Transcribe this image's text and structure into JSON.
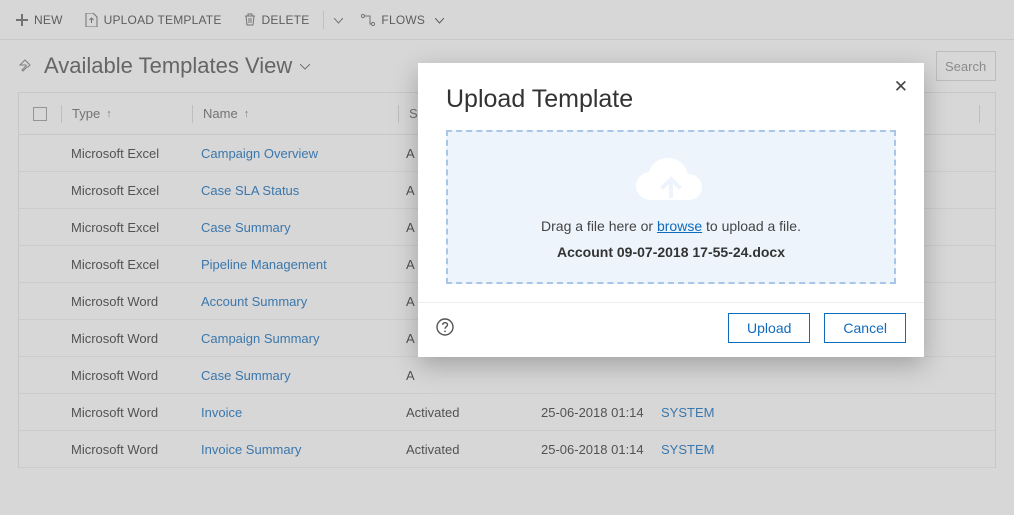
{
  "toolbar": {
    "new_label": "NEW",
    "upload_template_label": "UPLOAD TEMPLATE",
    "delete_label": "DELETE",
    "flows_label": "FLOWS"
  },
  "view": {
    "title": "Available Templates View",
    "search_placeholder": "Search"
  },
  "grid": {
    "columns": {
      "type": "Type",
      "name": "Name",
      "status": "S",
      "modified": "",
      "modified_by": ""
    },
    "rows": [
      {
        "type": "Microsoft Excel",
        "name": "Campaign Overview",
        "status": "A",
        "modified": "",
        "modified_by": ""
      },
      {
        "type": "Microsoft Excel",
        "name": "Case SLA Status",
        "status": "A",
        "modified": "",
        "modified_by": ""
      },
      {
        "type": "Microsoft Excel",
        "name": "Case Summary",
        "status": "A",
        "modified": "",
        "modified_by": ""
      },
      {
        "type": "Microsoft Excel",
        "name": "Pipeline Management",
        "status": "A",
        "modified": "",
        "modified_by": ""
      },
      {
        "type": "Microsoft Word",
        "name": "Account Summary",
        "status": "A",
        "modified": "",
        "modified_by": ""
      },
      {
        "type": "Microsoft Word",
        "name": "Campaign Summary",
        "status": "A",
        "modified": "",
        "modified_by": ""
      },
      {
        "type": "Microsoft Word",
        "name": "Case Summary",
        "status": "A",
        "modified": "",
        "modified_by": ""
      },
      {
        "type": "Microsoft Word",
        "name": "Invoice",
        "status": "Activated",
        "modified": "25-06-2018 01:14",
        "modified_by": "SYSTEM"
      },
      {
        "type": "Microsoft Word",
        "name": "Invoice Summary",
        "status": "Activated",
        "modified": "25-06-2018 01:14",
        "modified_by": "SYSTEM"
      }
    ]
  },
  "modal": {
    "title": "Upload Template",
    "dropzone_prefix": "Drag a file here or ",
    "dropzone_browse": "browse",
    "dropzone_suffix": " to upload a file.",
    "selected_file": "Account 09-07-2018 17-55-24.docx",
    "upload_label": "Upload",
    "cancel_label": "Cancel"
  }
}
